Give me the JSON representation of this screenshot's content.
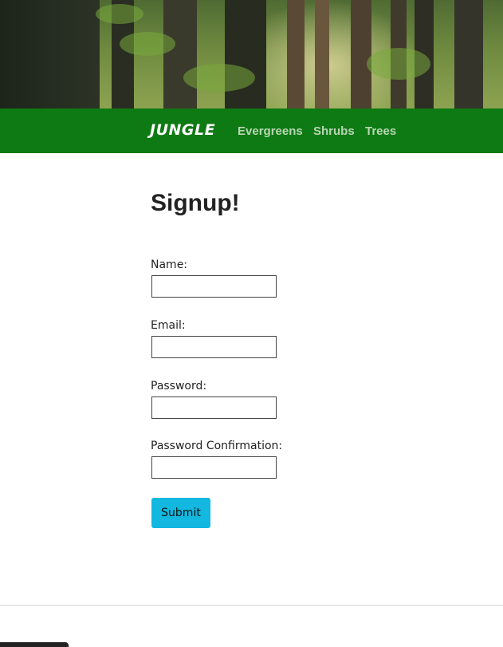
{
  "nav": {
    "brand": "JUNGLE",
    "links": [
      "Evergreens",
      "Shrubs",
      "Trees"
    ]
  },
  "page": {
    "title": "Signup!"
  },
  "form": {
    "fields": [
      {
        "label": "Name:",
        "value": ""
      },
      {
        "label": "Email:",
        "value": ""
      },
      {
        "label": "Password:",
        "value": ""
      },
      {
        "label": "Password Confirmation:",
        "value": ""
      }
    ],
    "submit_label": "Submit"
  },
  "colors": {
    "navbar": "#0e7a13",
    "nav_link": "#b8d6b5",
    "submit": "#12b8e0"
  },
  "icons": {
    "hero": "forest-banner-image"
  }
}
